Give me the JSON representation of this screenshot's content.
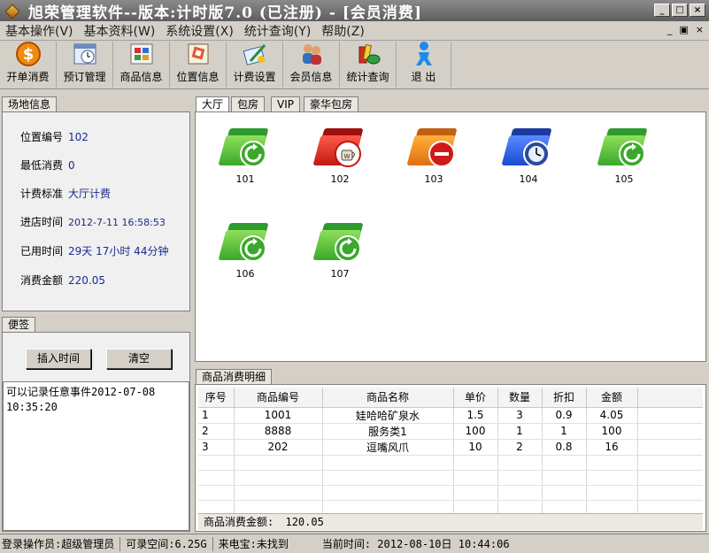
{
  "window": {
    "title": "旭荣管理软件--版本:计时版7.0 (已注册) - [会员消费]"
  },
  "menu": [
    "基本操作(V)",
    "基本资料(W)",
    "系统设置(X)",
    "统计查询(Y)",
    "帮助(Z)"
  ],
  "toolbar": [
    {
      "label": "开单消费",
      "icon": "dollar-coin-icon"
    },
    {
      "label": "预订管理",
      "icon": "calendar-clock-icon"
    },
    {
      "label": "商品信息",
      "icon": "grid-icon"
    },
    {
      "label": "位置信息",
      "icon": "card-icon"
    },
    {
      "label": "计费设置",
      "icon": "pen-card-icon"
    },
    {
      "label": "会员信息",
      "icon": "users-icon"
    },
    {
      "label": "统计查询",
      "icon": "stats-icon"
    },
    {
      "label": "退  出",
      "icon": "exit-person-icon"
    }
  ],
  "site_panel": {
    "tab": "场地信息",
    "fields": [
      {
        "label": "位置编号",
        "value": "102"
      },
      {
        "label": "最低消费",
        "value": "0"
      },
      {
        "label": "计费标准",
        "value": "大厅计费"
      },
      {
        "label": "进店时间",
        "value": "2012-7-11 16:58:53"
      },
      {
        "label": "已用时间",
        "value": "29天 17小时 44分钟"
      },
      {
        "label": "消费金额",
        "value": "220.05"
      }
    ]
  },
  "memo_panel": {
    "tab": "便签",
    "insert_time": "插入时间",
    "clear": "清空",
    "text_line1": "可以记录任意事件2012-07-08",
    "text_line2": "10:35:20"
  },
  "room_tabs": [
    "大厅",
    "包房",
    "VIP",
    "豪华包房"
  ],
  "rooms": [
    {
      "num": "101",
      "status": "green",
      "badge": "refresh"
    },
    {
      "num": "102",
      "status": "red",
      "badge": "teacup"
    },
    {
      "num": "103",
      "status": "orange",
      "badge": "no-entry"
    },
    {
      "num": "104",
      "status": "blue",
      "badge": "clock"
    },
    {
      "num": "105",
      "status": "green",
      "badge": "refresh"
    },
    {
      "num": "106",
      "status": "green",
      "badge": "refresh"
    },
    {
      "num": "107",
      "status": "green",
      "badge": "refresh"
    }
  ],
  "detail": {
    "tab": "商品消费明细",
    "columns": [
      "序号",
      "商品编号",
      "商品名称",
      "单价",
      "数量",
      "折扣",
      "金额"
    ],
    "rows": [
      [
        "1",
        "1001",
        "娃哈哈矿泉水",
        "1.5",
        "3",
        "0.9",
        "4.05"
      ],
      [
        "2",
        "8888",
        "服务类1",
        "100",
        "1",
        "1",
        "100"
      ],
      [
        "3",
        "202",
        "逗嘴风爪",
        "10",
        "2",
        "0.8",
        "16"
      ]
    ],
    "total_label": "商品消费金额:",
    "total_value": "120.05"
  },
  "status": {
    "operator": "登录操作员:超级管理员",
    "space": "可录空间:6.25G",
    "caller": "来电宝:未找到",
    "time": "当前时间: 2012-08-10日 10:44:06"
  }
}
